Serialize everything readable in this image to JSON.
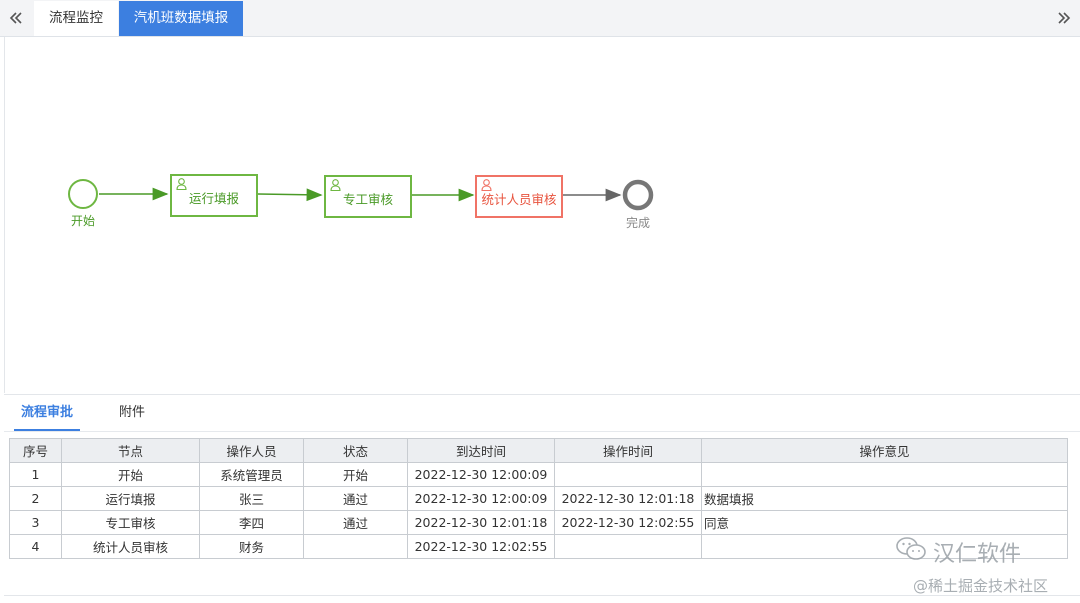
{
  "tabs": [
    {
      "label": "流程监控",
      "active": false
    },
    {
      "label": "汽机班数据填报",
      "active": true
    }
  ],
  "workflow": {
    "start_label": "开始",
    "tasks": [
      {
        "label": "运行填报",
        "status": "done"
      },
      {
        "label": "专工审核",
        "status": "done"
      },
      {
        "label": "统计人员审核",
        "status": "active"
      }
    ],
    "end_label": "完成"
  },
  "subtabs": [
    {
      "label": "流程审批",
      "active": true
    },
    {
      "label": "附件",
      "active": false
    }
  ],
  "table": {
    "headers": [
      "序号",
      "节点",
      "操作人员",
      "状态",
      "到达时间",
      "操作时间",
      "操作意见"
    ],
    "rows": [
      [
        "1",
        "开始",
        "系统管理员",
        "开始",
        "2022-12-30 12:00:09",
        "",
        ""
      ],
      [
        "2",
        "运行填报",
        "张三",
        "通过",
        "2022-12-30 12:00:09",
        "2022-12-30 12:01:18",
        "数据填报"
      ],
      [
        "3",
        "专工审核",
        "李四",
        "通过",
        "2022-12-30 12:01:18",
        "2022-12-30 12:02:55",
        "同意"
      ],
      [
        "4",
        "统计人员审核",
        "财务",
        "",
        "2022-12-30 12:02:55",
        "",
        ""
      ]
    ]
  },
  "watermark": {
    "line1": "汉仁软件",
    "line2": "@稀土掘金技术社区"
  },
  "colors": {
    "accent": "#3c7fe0",
    "done": "#6eb742",
    "active": "#f07366",
    "end": "#777777"
  }
}
